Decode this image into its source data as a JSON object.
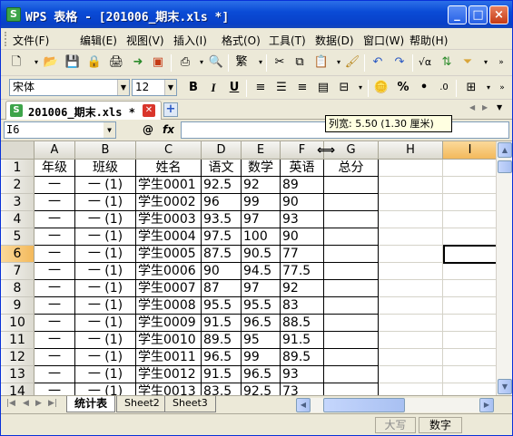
{
  "window": {
    "title": "WPS 表格 - [201006_期末.xls *]",
    "app_icon_label": "S",
    "minimize_icon": "minimize-icon",
    "maximize_icon": "maximize-icon",
    "close_icon": "close-icon"
  },
  "menu": [
    "文件(F)",
    "编辑(E)",
    "视图(V)",
    "插入(I)",
    "格式(O)",
    "工具(T)",
    "数据(D)",
    "窗口(W)",
    "帮助(H)"
  ],
  "format_bar": {
    "font_name": "宋体",
    "font_size": "12",
    "bold": "B",
    "italic": "I",
    "underline": "U",
    "percent": "%",
    "thousands": "•"
  },
  "doc_tab": {
    "name": "201006_期末.xls *",
    "icon_label": "S"
  },
  "tooltip": "列宽: 5.50 (1.30 厘米)",
  "formula_bar": {
    "cell_ref": "I6",
    "fx_label": "fx",
    "formula": ""
  },
  "columns": [
    "A",
    "B",
    "C",
    "D",
    "E",
    "F",
    "G",
    "H",
    "I"
  ],
  "selected_column": "I",
  "selected_row": "6",
  "rows": [
    "1",
    "2",
    "3",
    "4",
    "5",
    "6",
    "7",
    "8",
    "9",
    "10",
    "11",
    "12",
    "13",
    "14"
  ],
  "table": {
    "headers": [
      "年级",
      "班级",
      "姓名",
      "语文",
      "数学",
      "英语",
      "总分"
    ],
    "data": [
      [
        "一",
        "一 (1)",
        "学生0001",
        "92.5",
        "92",
        "89",
        ""
      ],
      [
        "一",
        "一 (1)",
        "学生0002",
        "96",
        "99",
        "90",
        ""
      ],
      [
        "一",
        "一 (1)",
        "学生0003",
        "93.5",
        "97",
        "93",
        ""
      ],
      [
        "一",
        "一 (1)",
        "学生0004",
        "97.5",
        "100",
        "90",
        ""
      ],
      [
        "一",
        "一 (1)",
        "学生0005",
        "87.5",
        "90.5",
        "77",
        ""
      ],
      [
        "一",
        "一 (1)",
        "学生0006",
        "90",
        "94.5",
        "77.5",
        ""
      ],
      [
        "一",
        "一 (1)",
        "学生0007",
        "87",
        "97",
        "92",
        ""
      ],
      [
        "一",
        "一 (1)",
        "学生0008",
        "95.5",
        "95.5",
        "83",
        ""
      ],
      [
        "一",
        "一 (1)",
        "学生0009",
        "91.5",
        "96.5",
        "88.5",
        ""
      ],
      [
        "一",
        "一 (1)",
        "学生0010",
        "89.5",
        "95",
        "91.5",
        ""
      ],
      [
        "一",
        "一 (1)",
        "学生0011",
        "96.5",
        "99",
        "89.5",
        ""
      ],
      [
        "一",
        "一 (1)",
        "学生0012",
        "91.5",
        "96.5",
        "93",
        ""
      ],
      [
        "一",
        "一 (1)",
        "学生0013",
        "83.5",
        "92.5",
        "73",
        ""
      ]
    ]
  },
  "sheets": [
    "统计表",
    "Sheet2",
    "Sheet3"
  ],
  "active_sheet": "统计表",
  "status": {
    "caps": "大写",
    "num": "数字"
  },
  "colors": {
    "title_bar": "#0a4bd6",
    "selected_header": "#f3b95b",
    "app_green": "#3da44a"
  }
}
